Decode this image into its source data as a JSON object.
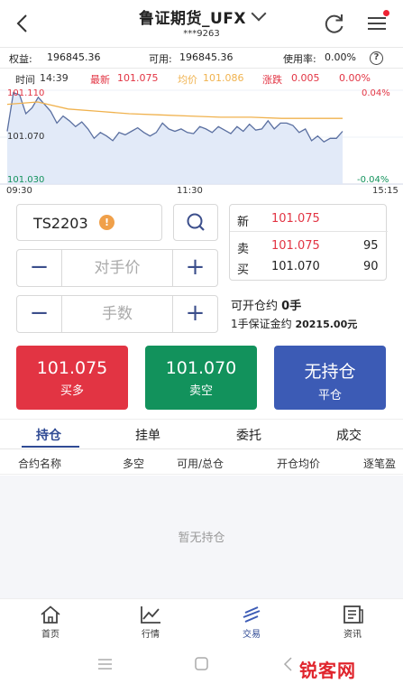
{
  "header": {
    "title": "鲁证期货_UFX",
    "account": "***9263"
  },
  "account_bar": {
    "equity_label": "权益:",
    "equity": "196845.36",
    "available_label": "可用:",
    "available": "196845.36",
    "usage_label": "使用率:",
    "usage": "0.00%"
  },
  "chart_header": {
    "time_label": "时间",
    "time": "14:39",
    "latest_label": "最新",
    "latest": "101.075",
    "avg_label": "均价",
    "avg": "101.086",
    "change_label": "涨跌",
    "change": "0.005",
    "pct": "0.00%"
  },
  "chart_data": {
    "type": "line",
    "y_labels": [
      "101.110",
      "101.070",
      "101.030"
    ],
    "pct_labels": [
      "0.04%",
      "-0.04%"
    ],
    "x_labels": [
      "09:30",
      "11:30",
      "15:15"
    ],
    "ylim": [
      101.03,
      101.11
    ],
    "series": [
      {
        "values": [
          101.075,
          101.108,
          101.106,
          101.09,
          101.095,
          101.104,
          101.098,
          101.092,
          101.082,
          101.088,
          101.084,
          101.079,
          101.083,
          101.077,
          101.069,
          101.074,
          101.071,
          101.067,
          101.074,
          101.072,
          101.075,
          101.078,
          101.074,
          101.071,
          101.074,
          101.082,
          101.077,
          101.075,
          101.077,
          101.074,
          101.073,
          101.079,
          101.077,
          101.074,
          101.079,
          101.076,
          101.073,
          101.079,
          101.075,
          101.081,
          101.076,
          101.077,
          101.084,
          101.077,
          101.082,
          101.082,
          101.08,
          101.074,
          101.077,
          101.067,
          101.071,
          101.066,
          101.069,
          101.069,
          101.075
        ]
      },
      {
        "values": [
          101.098,
          101.1,
          101.094,
          101.092,
          101.09,
          101.089,
          101.088,
          101.087,
          101.087,
          101.086,
          101.086,
          101.086
        ]
      }
    ],
    "colors": {
      "price": "#5a6fa0",
      "average": "#f0b24e",
      "fill": "#dfe8f7"
    }
  },
  "order": {
    "contract": "TS2203",
    "warn_icon": "!",
    "price_placeholder": "对手价",
    "qty_placeholder": "手数",
    "minus": "−",
    "plus": "+"
  },
  "quote": {
    "new_label": "新",
    "new_price": "101.075",
    "ask_label": "卖",
    "ask_price": "101.075",
    "ask_qty": "95",
    "bid_label": "买",
    "bid_price": "101.070",
    "bid_qty": "90"
  },
  "info": {
    "open_label": "可开仓约",
    "open_value": "0手",
    "margin_label": "1手保证金约",
    "margin_value": "20215.00元"
  },
  "buttons": {
    "buy_price": "101.075",
    "buy_label": "买多",
    "sell_price": "101.070",
    "sell_label": "卖空",
    "close_title": "无持仓",
    "close_label": "平仓",
    "colors": {
      "buy": "#e23443",
      "sell": "#12925c",
      "close": "#3c5bb5"
    }
  },
  "tabs": [
    "持仓",
    "挂单",
    "委托",
    "成交"
  ],
  "table_headers": [
    "合约名称",
    "多空",
    "可用/总仓",
    "开仓均价",
    "逐笔盈"
  ],
  "empty_text": "暂无持仓",
  "bottom_nav": [
    {
      "label": "首页",
      "icon": "home-icon"
    },
    {
      "label": "行情",
      "icon": "chart-icon"
    },
    {
      "label": "交易",
      "icon": "trade-icon"
    },
    {
      "label": "资讯",
      "icon": "news-icon"
    }
  ],
  "watermark": "锐客网"
}
